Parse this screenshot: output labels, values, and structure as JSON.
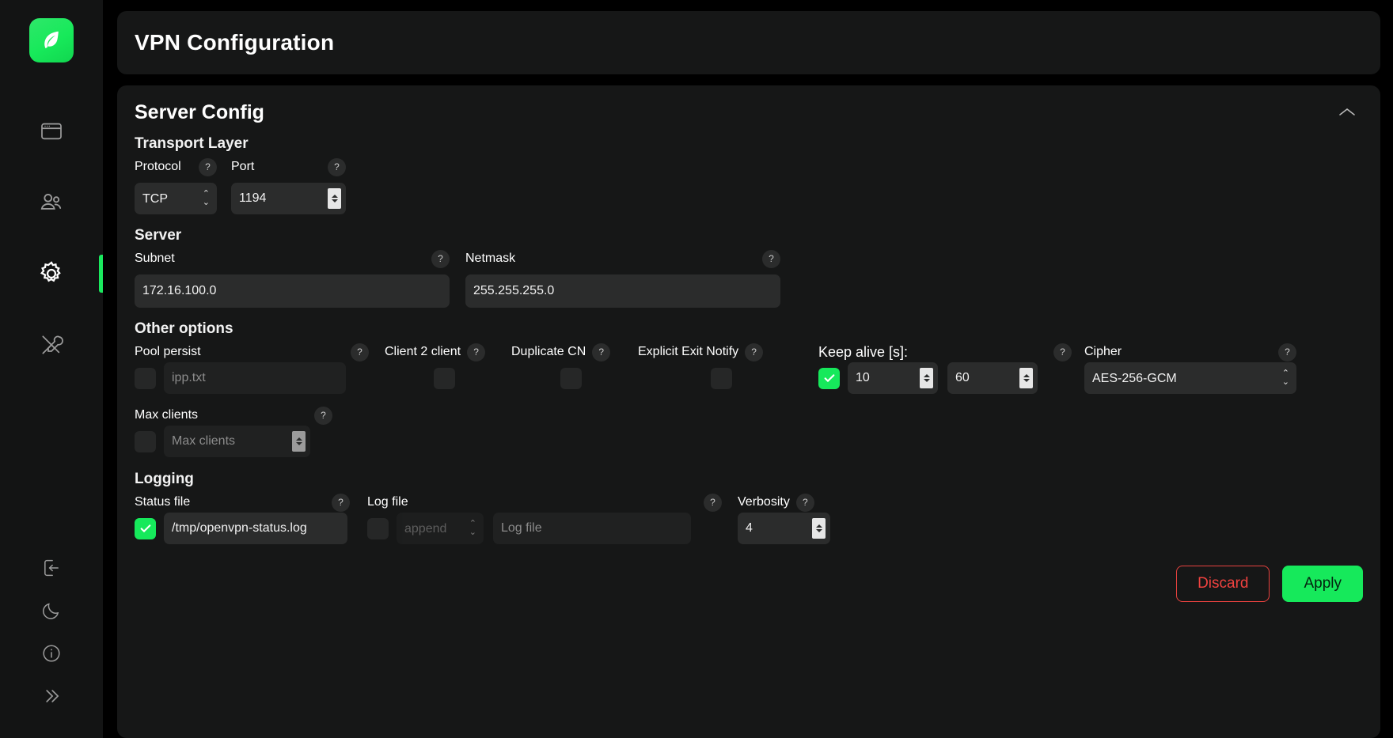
{
  "sidebar": {
    "logo_name": "leaf-logo",
    "items": [
      {
        "name": "sidebar-item-dashboard",
        "icon": "window-icon",
        "active": false
      },
      {
        "name": "sidebar-item-users",
        "icon": "users-icon",
        "active": false
      },
      {
        "name": "sidebar-item-settings",
        "icon": "gear-icon",
        "active": true
      },
      {
        "name": "sidebar-item-tools",
        "icon": "tools-icon",
        "active": false
      }
    ],
    "bottom_items": [
      {
        "name": "sidebar-item-logout",
        "icon": "logout-icon"
      },
      {
        "name": "sidebar-item-theme",
        "icon": "moon-icon"
      },
      {
        "name": "sidebar-item-info",
        "icon": "info-icon"
      },
      {
        "name": "sidebar-item-expand",
        "icon": "chevron-double-right-icon"
      }
    ]
  },
  "header": {
    "title": "VPN Configuration"
  },
  "server_config": {
    "title": "Server Config",
    "collapse_icon": "chevron-up-icon",
    "transport": {
      "title": "Transport Layer",
      "protocol": {
        "label": "Protocol",
        "value": "TCP",
        "help": "?"
      },
      "port": {
        "label": "Port",
        "value": "1194",
        "help": "?"
      }
    },
    "server": {
      "title": "Server",
      "subnet": {
        "label": "Subnet",
        "value": "172.16.100.0",
        "help": "?"
      },
      "netmask": {
        "label": "Netmask",
        "value": "255.255.255.0",
        "help": "?"
      }
    },
    "other": {
      "title": "Other options",
      "pool_persist": {
        "label": "Pool persist",
        "help": "?",
        "checked": false,
        "placeholder": "ipp.txt",
        "value": ""
      },
      "client2client": {
        "label": "Client 2 client",
        "help": "?",
        "checked": false
      },
      "duplicate_cn": {
        "label": "Duplicate CN",
        "help": "?",
        "checked": false
      },
      "explicit_exit_notify": {
        "label": "Explicit Exit Notify",
        "help": "?",
        "checked": false
      },
      "keep_alive": {
        "label": "Keep alive [s]:",
        "help": "?",
        "checked": true,
        "interval": "10",
        "timeout": "60"
      },
      "cipher": {
        "label": "Cipher",
        "help": "?",
        "value": "AES-256-GCM"
      },
      "max_clients": {
        "label": "Max clients",
        "help": "?",
        "checked": false,
        "placeholder": "Max clients",
        "value": ""
      }
    },
    "logging": {
      "title": "Logging",
      "status_file": {
        "label": "Status file",
        "help": "?",
        "checked": true,
        "value": "/tmp/openvpn-status.log"
      },
      "log_file": {
        "label": "Log file",
        "help": "?",
        "checked": false,
        "mode": "append",
        "placeholder": "Log file",
        "value": ""
      },
      "verbosity": {
        "label": "Verbosity",
        "help": "?",
        "value": "4"
      }
    },
    "actions": {
      "discard": "Discard",
      "apply": "Apply"
    }
  },
  "colors": {
    "accent_green": "#16e95b",
    "danger_red": "#f0423f",
    "panel_bg": "#161717",
    "input_bg": "#2b2c2c"
  }
}
